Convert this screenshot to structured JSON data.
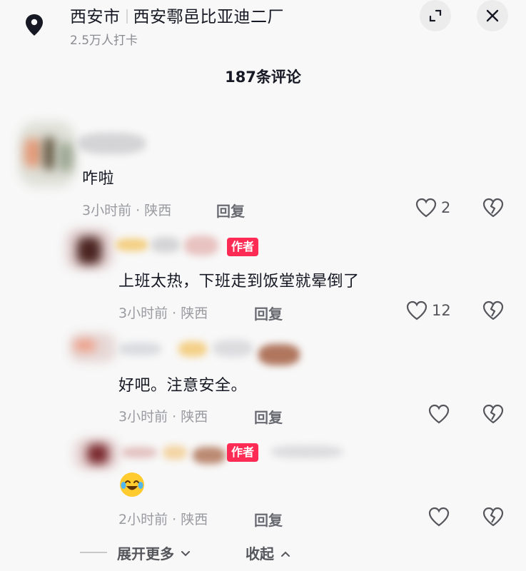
{
  "header": {
    "city": "西安市",
    "place": "西安鄠邑比亚迪二厂",
    "checkins": "2.5万人打卡",
    "icons": {
      "pin": "location-pin-icon",
      "expand": "expand-icon",
      "close": "close-icon"
    }
  },
  "comment_count": "187条评论",
  "colors": {
    "author_tag": "#fe2c55",
    "text": "#161823",
    "meta": "#9a9ba1",
    "emoji": "#ffcb2e"
  },
  "comments": [
    {
      "text": "咋啦",
      "time": "3小时前",
      "region": "陕西",
      "reply": "回复",
      "likes": "2",
      "author": false
    },
    {
      "text": "上班太热，下班走到饭堂就晕倒了",
      "time": "3小时前",
      "region": "陕西",
      "reply": "回复",
      "likes": "12",
      "author": true,
      "author_label": "作者"
    },
    {
      "text": "好吧。注意安全。",
      "time": "3小时前",
      "region": "陕西",
      "reply": "回复",
      "likes": "",
      "author": false
    },
    {
      "text": "",
      "emoji": "crying-laughing-emoji",
      "time": "2小时前",
      "region": "陕西",
      "reply": "回复",
      "likes": "",
      "author": true,
      "author_label": "作者"
    }
  ],
  "footer": {
    "expand_more": "展开更多",
    "collapse": "收起"
  }
}
